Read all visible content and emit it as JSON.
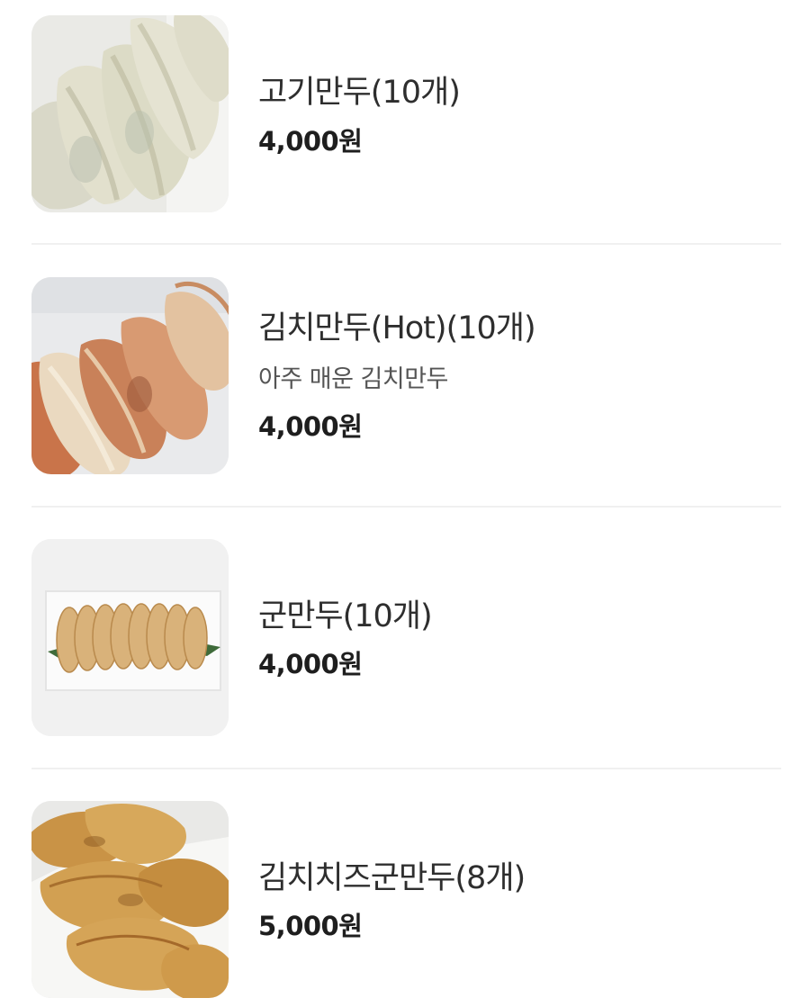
{
  "menu": {
    "items": [
      {
        "name": "고기만두(10개)",
        "description": "",
        "price": "4,000원",
        "image": "steamed-meat-dumplings"
      },
      {
        "name": "김치만두(Hot)(10개)",
        "description": "아주 매운 김치만두",
        "price": "4,000원",
        "image": "kimchi-dumplings"
      },
      {
        "name": "군만두(10개)",
        "description": "",
        "price": "4,000원",
        "image": "pan-fried-dumplings-row"
      },
      {
        "name": "김치치즈군만두(8개)",
        "description": "",
        "price": "5,000원",
        "image": "fried-kimchi-cheese-dumplings"
      }
    ]
  }
}
